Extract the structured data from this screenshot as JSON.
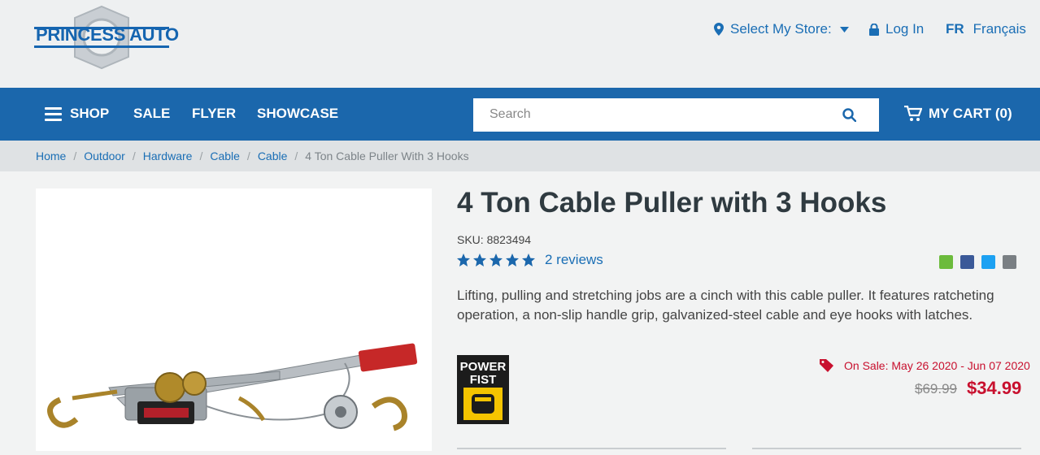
{
  "header": {
    "logo_text": "PRINCESS AUTO",
    "select_store": "Select My Store:",
    "login": "Log In",
    "lang_code": "FR",
    "lang_name": "Français"
  },
  "nav": {
    "shop": "SHOP",
    "sale": "SALE",
    "flyer": "FLYER",
    "showcase": "SHOWCASE",
    "search_placeholder": "Search",
    "cart": "MY CART (0)"
  },
  "breadcrumb": [
    "Home",
    "Outdoor",
    "Hardware",
    "Cable",
    "Cable",
    "4 Ton Cable Puller With 3 Hooks"
  ],
  "product": {
    "title": "4 Ton Cable Puller with 3 Hooks",
    "sku": "SKU: 8823494",
    "rating": 5,
    "reviews": "2 reviews",
    "description": "Lifting, pulling and stretching jobs are a cinch with this cable puller. It features ratcheting operation, a non-slip handle grip, galvanized-steel cable and eye hooks with latches.",
    "brand_line1": "POWER",
    "brand_line2": "FIST",
    "sale_text": "On Sale: May 26 2020 - Jun 07 2020",
    "old_price": "$69.99",
    "price": "$34.99"
  },
  "colors": {
    "primary": "#1b67ac",
    "sale": "#c8102e"
  }
}
